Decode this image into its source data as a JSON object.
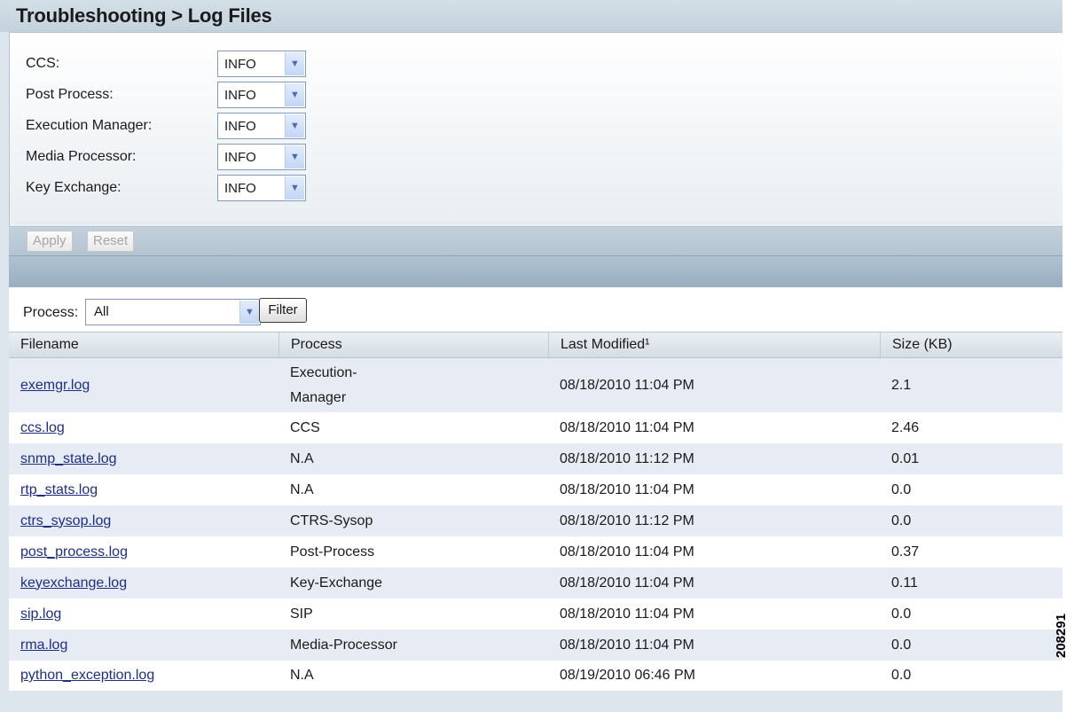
{
  "title": "Troubleshooting > Log Files",
  "log_levels": [
    {
      "label": "CCS:",
      "value": "INFO"
    },
    {
      "label": "Post Process:",
      "value": "INFO"
    },
    {
      "label": "Execution Manager:",
      "value": "INFO"
    },
    {
      "label": "Media Processor:",
      "value": "INFO"
    },
    {
      "label": "Key Exchange:",
      "value": "INFO"
    }
  ],
  "actions": {
    "apply_label": "Apply",
    "reset_label": "Reset"
  },
  "filter": {
    "label": "Process:",
    "selected": "All",
    "button_label": "Filter"
  },
  "table": {
    "headers": [
      "Filename",
      "Process",
      "Last Modified¹",
      "Size (KB)"
    ],
    "rows": [
      {
        "filename": "exemgr.log",
        "process_line1": "Execution-",
        "process_line2": "Manager",
        "modified": "08/18/2010 11:04 PM",
        "size": "2.1"
      },
      {
        "filename": "ccs.log",
        "process": "CCS",
        "modified": "08/18/2010 11:04 PM",
        "size": "2.46"
      },
      {
        "filename": "snmp_state.log",
        "process": "N.A",
        "modified": "08/18/2010 11:12 PM",
        "size": "0.01"
      },
      {
        "filename": "rtp_stats.log",
        "process": "N.A",
        "modified": "08/18/2010 11:04 PM",
        "size": "0.0"
      },
      {
        "filename": "ctrs_sysop.log",
        "process": "CTRS-Sysop",
        "modified": "08/18/2010 11:12 PM",
        "size": "0.0"
      },
      {
        "filename": "post_process.log",
        "process": "Post-Process",
        "modified": "08/18/2010 11:04 PM",
        "size": "0.37"
      },
      {
        "filename": "keyexchange.log",
        "process": "Key-Exchange",
        "modified": "08/18/2010 11:04 PM",
        "size": "0.11"
      },
      {
        "filename": "sip.log",
        "process": "SIP",
        "modified": "08/18/2010 11:04 PM",
        "size": "0.0"
      },
      {
        "filename": "rma.log",
        "process": "Media-Processor",
        "modified": "08/18/2010 11:04 PM",
        "size": "0.0"
      },
      {
        "filename": "python_exception.log",
        "process": "N.A",
        "modified": "08/19/2010 06:46 PM",
        "size": "0.0"
      }
    ]
  },
  "figure_number": "208291",
  "icons": {
    "dropdown": "chevron-down-icon"
  }
}
